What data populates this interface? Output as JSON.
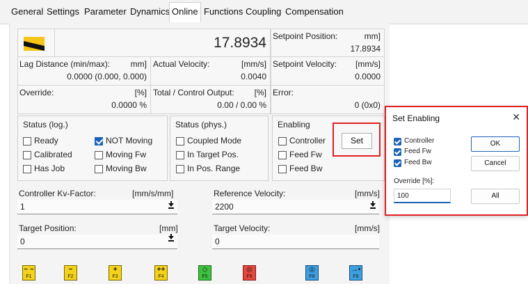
{
  "tabs": [
    "General",
    "Settings",
    "Parameter",
    "Dynamics",
    "Online",
    "Functions",
    "Coupling",
    "Compensation"
  ],
  "active_tab": "Online",
  "online": {
    "position_value": "17.8934",
    "setpoint_position_label": "Setpoint Position:",
    "setpoint_position_unit": "mm]",
    "setpoint_position_value": "17.8934",
    "lag_distance_label": "Lag Distance (min/max):",
    "lag_distance_unit": "mm]",
    "lag_distance_value": "0.0000 (0.000, 0.000)",
    "actual_velocity_label": "Actual Velocity:",
    "actual_velocity_unit": "[mm/s]",
    "actual_velocity_value": "0.0040",
    "setpoint_velocity_label": "Setpoint Velocity:",
    "setpoint_velocity_unit": "[mm/s]",
    "setpoint_velocity_value": "0.0000",
    "override_label": "Override:",
    "override_unit": "[%]",
    "override_value": "0.0000 %",
    "total_output_label": "Total / Control Output:",
    "total_output_unit": "[%]",
    "total_output_value": "0.00 / 0.00 %",
    "error_label": "Error:",
    "error_value": "0 (0x0)"
  },
  "status_log": {
    "title": "Status (log.)",
    "items": [
      {
        "label": "Ready",
        "checked": false
      },
      {
        "label": "Calibrated",
        "checked": false
      },
      {
        "label": "Has Job",
        "checked": false
      },
      {
        "label": "NOT Moving",
        "checked": true
      },
      {
        "label": "Moving Fw",
        "checked": false
      },
      {
        "label": "Moving Bw",
        "checked": false
      }
    ]
  },
  "status_phys": {
    "title": "Status (phys.)",
    "items": [
      {
        "label": "Coupled Mode",
        "checked": false
      },
      {
        "label": "In Target Pos.",
        "checked": false
      },
      {
        "label": "In Pos. Range",
        "checked": false
      }
    ]
  },
  "enabling": {
    "title": "Enabling",
    "items": [
      {
        "label": "Controller",
        "checked": false
      },
      {
        "label": "Feed Fw",
        "checked": false
      },
      {
        "label": "Feed Bw",
        "checked": false
      }
    ],
    "set_label": "Set"
  },
  "fields": {
    "kv_label": "Controller Kv-Factor:",
    "kv_unit": "[mm/s/mm]",
    "kv_value": "1",
    "ref_vel_label": "Reference Velocity:",
    "ref_vel_unit": "[mm/s]",
    "ref_vel_value": "2200",
    "target_pos_label": "Target Position:",
    "target_pos_unit": "[mm]",
    "target_pos_value": "0",
    "target_vel_label": "Target Velocity:",
    "target_vel_unit": "[mm/s]",
    "target_vel_value": "0"
  },
  "function_keys": [
    {
      "label": "F1",
      "glyph": "− −",
      "color": "#f5d21a"
    },
    {
      "label": "F2",
      "glyph": "−",
      "color": "#f5d21a"
    },
    {
      "label": "F3",
      "glyph": "+",
      "color": "#f5d21a"
    },
    {
      "label": "F4",
      "glyph": "++",
      "color": "#f5d21a"
    },
    {
      "label": "F5",
      "glyph": "◇",
      "color": "#3cc23c"
    },
    {
      "label": "F6",
      "glyph": "◎",
      "color": "#e8463c"
    },
    {
      "label": "F8",
      "glyph": "◎",
      "color": "#3c9fe0"
    },
    {
      "label": "F9",
      "glyph": "→•",
      "color": "#3c9fe0"
    }
  ],
  "dialog": {
    "title": "Set Enabling",
    "close": "✕",
    "checks": [
      {
        "label": "Controller",
        "checked": true
      },
      {
        "label": "Feed Fw",
        "checked": true
      },
      {
        "label": "Feed Bw",
        "checked": true
      }
    ],
    "ok_label": "OK",
    "cancel_label": "Cancel",
    "override_label": "Override [%]:",
    "override_value": "100",
    "all_label": "All"
  },
  "colors": {
    "highlight": "#e02020",
    "check_blue": "#1b63b8"
  }
}
